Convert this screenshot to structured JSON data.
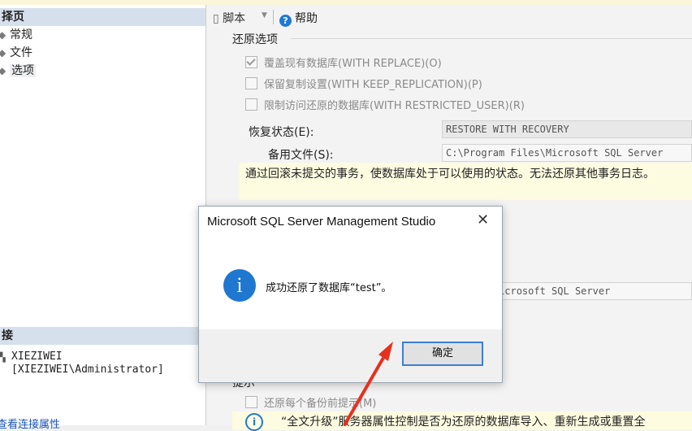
{
  "left_panel": {
    "header": "择页",
    "nav_items": [
      "常规",
      "文件",
      "选项"
    ],
    "connection_header": "接",
    "connection_server": "XIEZIWEI",
    "connection_user": "[XIEZIWEI\\Administrator]",
    "connection_link": "查看连接属性"
  },
  "toolbar": {
    "script_label": "脚本",
    "help_label": "帮助"
  },
  "restore_options": {
    "group_title": "还原选项",
    "options": [
      {
        "label": "覆盖现有数据库(WITH REPLACE)(O)",
        "checked": true
      },
      {
        "label": "保留复制设置(WITH KEEP_REPLICATION)(P)",
        "checked": false
      },
      {
        "label": "限制访问还原的数据库(WITH RESTRICTED_USER)(R)",
        "checked": false
      }
    ],
    "recovery_state_label": "恢复状态(E):",
    "recovery_state_value": "RESTORE WITH RECOVERY",
    "standby_file_label": "备用文件(S):",
    "standby_file_value": "C:\\Program Files\\Microsoft SQL Server",
    "description": "通过回滚未提交的事务，使数据库处于可以使用的状态。无法还原其他事务日志。",
    "background_path": "m Files\\Microsoft SQL Server"
  },
  "prompt": {
    "group_title": "提示",
    "option_label": "还原每个备份前提示(M)",
    "info_text": "“全文升级”服务器属性控制是否为还原的数据库导入、重新生成或重置全"
  },
  "dialog": {
    "title": "Microsoft SQL Server Management Studio",
    "message": "成功还原了数据库“test”。",
    "ok_button": "确定"
  },
  "colors": {
    "accent": "#1f77d0",
    "arrow": "#e8301e",
    "info_background": "#fdfbe0"
  }
}
